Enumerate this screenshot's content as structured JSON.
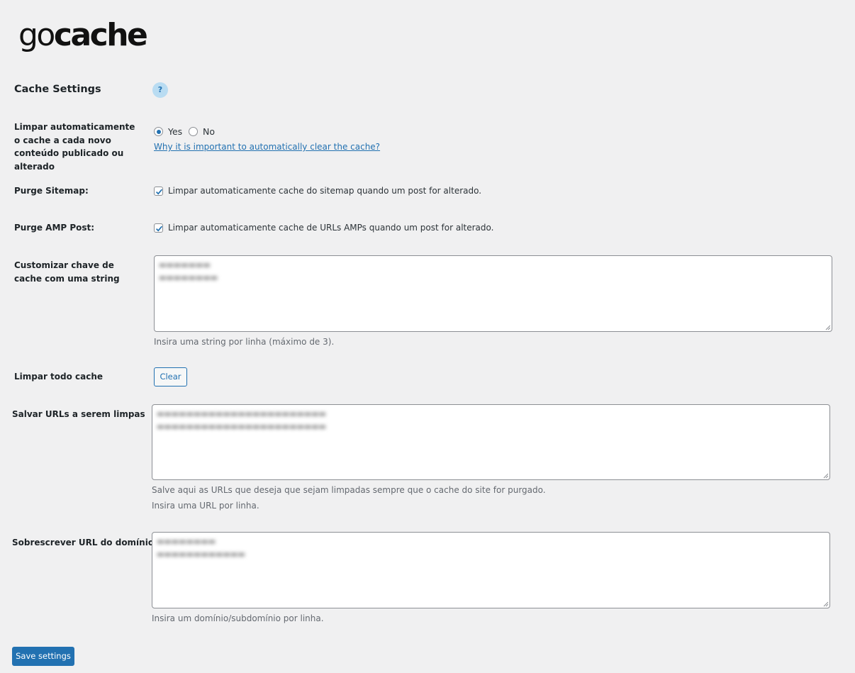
{
  "logo": {
    "part1": "go",
    "part2": "cache"
  },
  "section": {
    "title": "Cache Settings",
    "help_icon": "?"
  },
  "auto_clear": {
    "label": "Limpar automaticamente o cache a cada novo conteúdo publicado ou alterado",
    "yes_label": "Yes",
    "no_label": "No",
    "selected": "Yes",
    "link": "Why it is important to automatically clear the cache?"
  },
  "purge_sitemap": {
    "label": "Purge Sitemap:",
    "checked": true,
    "text": "Limpar automaticamente cache do sitemap quando um post for alterado."
  },
  "purge_amp": {
    "label": "Purge AMP Post:",
    "checked": true,
    "text": "Limpar automaticamente cache de URLs AMPs quando um post for alterado."
  },
  "cache_key": {
    "label": "Customizar chave de cache com uma string",
    "description": "Insira uma string por linha (máximo de 3)."
  },
  "clear_all": {
    "label": "Limpar todo cache",
    "button": "Clear"
  },
  "urls": {
    "label": "Salvar URLs a serem limpas",
    "description1": "Salve aqui as URLs que deseja que sejam limpadas sempre que o cache do site for purgado.",
    "description2": "Insira uma URL por linha."
  },
  "domain": {
    "label": "Sobrescrever URL do domínio",
    "description": "Insira um domínio/subdomínio por linha."
  },
  "save_button": "Save settings",
  "colors": {
    "accent": "#2271b1",
    "background": "#f0f0f1",
    "help_bg": "#b9dcf2"
  }
}
